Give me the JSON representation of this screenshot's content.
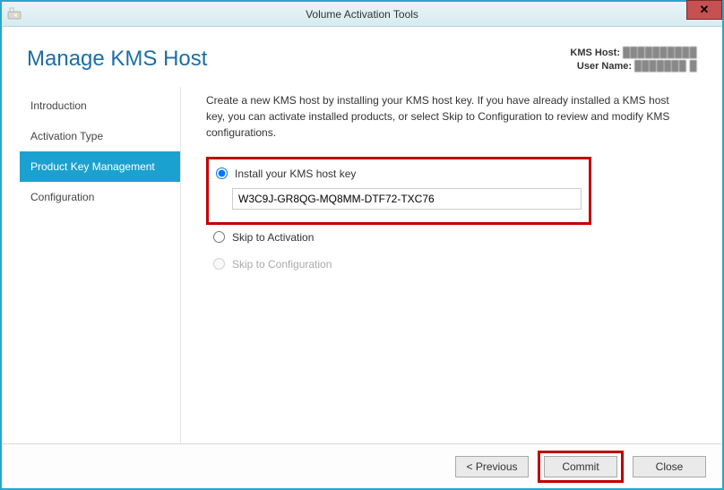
{
  "window": {
    "title": "Volume Activation Tools"
  },
  "header": {
    "page_title": "Manage KMS Host",
    "kms_host_label": "KMS Host:",
    "kms_host_value": "██████████",
    "user_name_label": "User Name:",
    "user_name_value": "███████ █"
  },
  "sidebar": {
    "items": [
      {
        "label": "Introduction",
        "active": false
      },
      {
        "label": "Activation Type",
        "active": false
      },
      {
        "label": "Product Key Management",
        "active": true
      },
      {
        "label": "Configuration",
        "active": false
      }
    ]
  },
  "content": {
    "description": "Create a new KMS host by installing your KMS host key. If you have already installed a KMS host key, you can activate installed products, or select Skip to Configuration to review and modify KMS configurations.",
    "options": {
      "install_label": "Install your KMS host key",
      "key_value": "W3C9J-GR8QG-MQ8MM-DTF72-TXC76",
      "skip_activation_label": "Skip to Activation",
      "skip_config_label": "Skip to Configuration"
    }
  },
  "footer": {
    "previous": "<  Previous",
    "commit": "Commit",
    "close": "Close"
  }
}
